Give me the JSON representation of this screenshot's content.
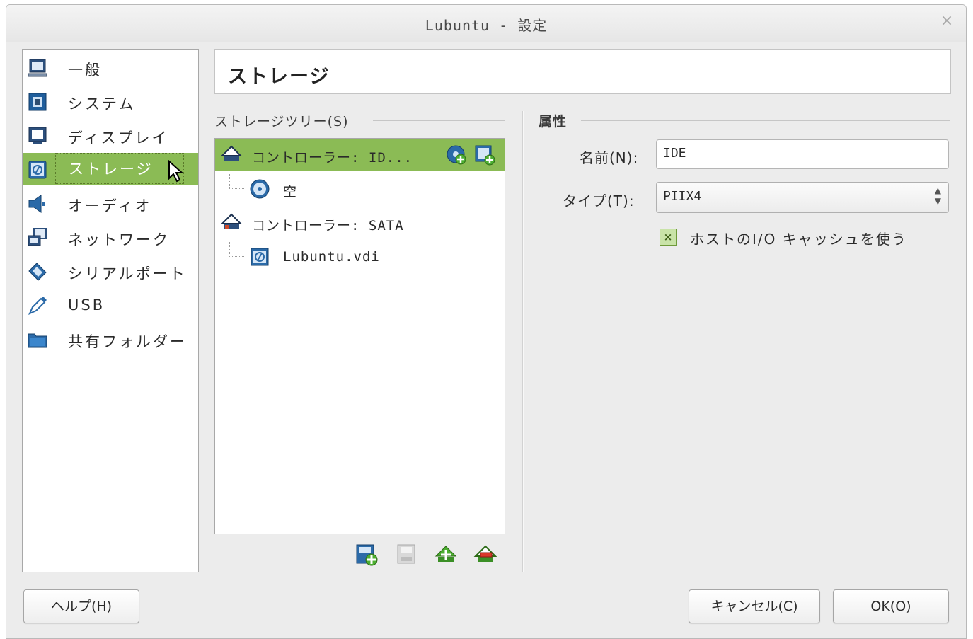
{
  "window": {
    "title": "Lubuntu - 設定",
    "close_glyph": "×"
  },
  "sidebar": {
    "items": [
      {
        "label": "一般",
        "icon": "computer-icon"
      },
      {
        "label": "システム",
        "icon": "chip-icon"
      },
      {
        "label": "ディスプレイ",
        "icon": "monitor-icon"
      },
      {
        "label": "ストレージ",
        "icon": "hard-disk-icon",
        "selected": true
      },
      {
        "label": "オーディオ",
        "icon": "speaker-icon"
      },
      {
        "label": "ネットワーク",
        "icon": "network-icon"
      },
      {
        "label": "シリアルポート",
        "icon": "serial-port-icon"
      },
      {
        "label": "USB",
        "icon": "usb-icon"
      },
      {
        "label": "共有フォルダー",
        "icon": "folder-icon"
      }
    ]
  },
  "header": {
    "title": "ストレージ"
  },
  "storage_tree": {
    "label": "ストレージツリー(S)",
    "label_mnemonic": "S",
    "nodes": [
      {
        "label": "コントローラー: ID...",
        "type": "controller",
        "selected": true
      },
      {
        "label": "空",
        "type": "optical"
      },
      {
        "label": "コントローラー: SATA",
        "type": "controller"
      },
      {
        "label": "Lubuntu.vdi",
        "type": "disk"
      }
    ],
    "toolbar": [
      "add-attachment-icon",
      "remove-attachment-icon",
      "add-controller-icon",
      "remove-controller-icon"
    ]
  },
  "attributes": {
    "section_label": "属性",
    "name_label": "名前(N):",
    "name_value": "IDE",
    "type_label": "タイプ(T):",
    "type_value": "PIIX4",
    "cache_label": "ホストのI/O キャッシュを使う",
    "cache_checked": true
  },
  "footer": {
    "help": "ヘルプ(H)",
    "cancel": "キャンセル(C)",
    "ok": "OK(O)"
  },
  "colors": {
    "selection": "#8bbb55",
    "window_bg": "#ececec"
  }
}
